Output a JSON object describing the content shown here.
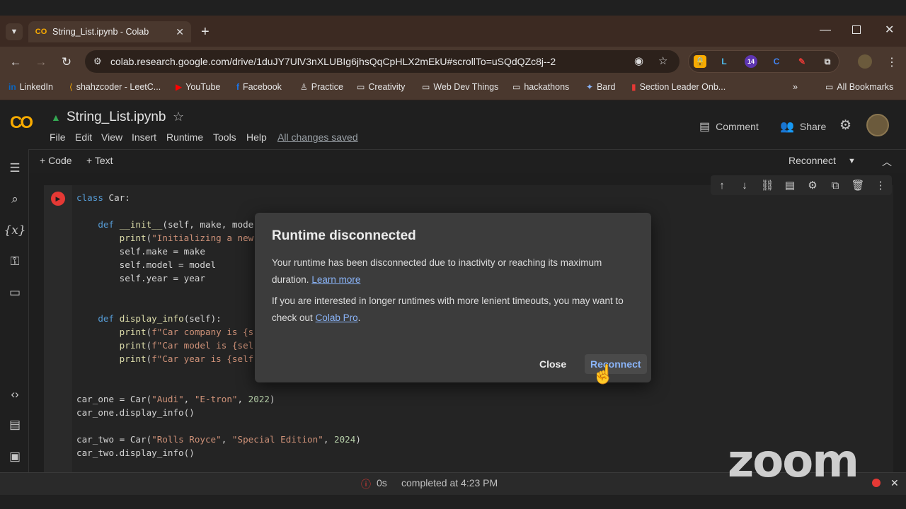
{
  "browser": {
    "tab_title": "String_List.ipynb - Colab",
    "url": "colab.research.google.com/drive/1duJY7UlV3nXLUBIg6jhsQqCpHLX2mEkU#scrollTo=uSQdQZc8j--2",
    "extension_badge": "14",
    "bookmarks": [
      "LinkedIn",
      "shahzcoder - LeetC...",
      "YouTube",
      "Facebook",
      "Practice",
      "Creativity",
      "Web Dev Things",
      "hackathons",
      "Bard",
      "Section Leader Onb..."
    ],
    "all_bookmarks": "All Bookmarks",
    "more_bookmarks": "»"
  },
  "colab": {
    "logo": "CO",
    "notebook_title": "String_List.ipynb",
    "menu": [
      "File",
      "Edit",
      "View",
      "Insert",
      "Runtime",
      "Tools",
      "Help"
    ],
    "saved_status": "All changes saved",
    "comment": "Comment",
    "share": "Share",
    "add_code": "+ Code",
    "add_text": "+ Text",
    "reconnect": "Reconnect"
  },
  "code_lines": [
    "class Car:",
    "",
    "    def __init__(self, make, mode",
    "        print(\"Initializing a new",
    "        self.make = make",
    "        self.model = model",
    "        self.year = year",
    "",
    "",
    "    def display_info(self):",
    "        print(f\"Car company is {s",
    "        print(f\"Car model is {sel",
    "        print(f\"Car year is {self",
    "",
    "",
    "car_one = Car(\"Audi\", \"E-tron\", 2022)",
    "car_one.display_info()",
    "",
    "car_two = Car(\"Rolls Royce\", \"Special Edition\", 2024)",
    "car_two.display_info()"
  ],
  "dialog": {
    "title": "Runtime disconnected",
    "p1": "Your runtime has been disconnected due to inactivity or reaching its maximum duration.",
    "p1_link": "Learn more",
    "p2": "If you are interested in longer runtimes with more lenient timeouts, you may want to check out",
    "p2_link": "Colab Pro",
    "close": "Close",
    "reconnect": "Reconnect"
  },
  "status": {
    "duration": "0s",
    "completed": "completed at 4:23 PM"
  },
  "overlay": {
    "zoom_watermark": "zoom"
  },
  "colors": {
    "accent": "#f9ab00",
    "link": "#8ab4f8",
    "error": "#e53935"
  }
}
